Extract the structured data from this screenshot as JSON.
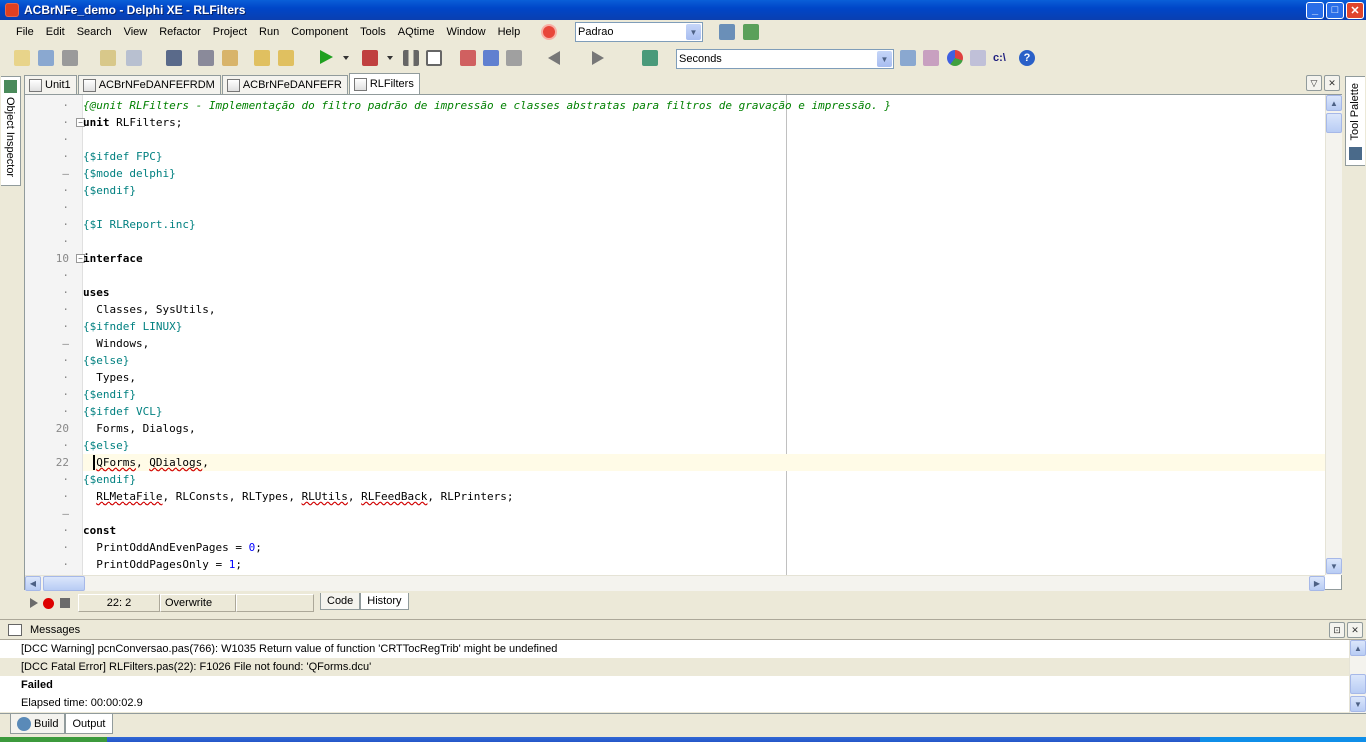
{
  "window": {
    "title": "ACBrNFe_demo - Delphi XE - RLFilters",
    "minimize": "_",
    "maximize": "□",
    "close": "✕"
  },
  "menubar": {
    "items": [
      "File",
      "Edit",
      "Search",
      "View",
      "Refactor",
      "Project",
      "Run",
      "Component",
      "Tools",
      "AQtime",
      "Window",
      "Help"
    ]
  },
  "desktop_combo": {
    "value": "Padrao"
  },
  "timing_combo": {
    "value": "Seconds"
  },
  "toolbar_icons": [
    "new-items-icon",
    "open-icon",
    "reopen-icon",
    "new-form-icon",
    "open-project-icon",
    "save-icon",
    "save-all-icon",
    "add-file-icon",
    "remove-file-icon",
    "run-icon",
    "run-without-debug-icon",
    "pause-icon",
    "stop-icon",
    "trace-into-icon",
    "step-over-icon",
    "run-to-cursor-icon",
    "back-icon",
    "forward-icon",
    "aqtime-icon",
    "components-icon",
    "help-icon"
  ],
  "side_left": {
    "label": "Object Inspector"
  },
  "side_right": {
    "label": "Tool Palette"
  },
  "editor_tabs": [
    {
      "label": "Unit1",
      "active": false
    },
    {
      "label": "ACBrNFeDANFEFRDM",
      "active": false
    },
    {
      "label": "ACBrNFeDANFEFR",
      "active": false
    },
    {
      "label": "RLFilters",
      "active": true
    }
  ],
  "code": {
    "comment_line": "{@unit RLFilters - Implementação do filtro padrão de impressão e classes abstratas para filtros de gravação e impressão. }",
    "unit_kw": "unit",
    "unit_name": " RLFilters;",
    "ifdef_fpc": "{$ifdef FPC}",
    "mode_delphi": "{$mode delphi}",
    "endif": "{$endif}",
    "include": "{$I RLReport.inc}",
    "interface": "interface",
    "uses": "uses",
    "classes_sysutils": "  Classes, SysUtils,",
    "ifndef_linux": "{$ifndef LINUX}",
    "windows": "  Windows,",
    "else": "{$else}",
    "types": "  Types,",
    "ifdef_vcl": "{$ifdef VCL}",
    "forms_dialogs": "  Forms, Dialogs,",
    "qforms": "QForms",
    "qdialogs": "QDialogs",
    "rlmetafile": "RLMetaFile",
    "rlconsts_types": ", RLConsts, RLTypes, ",
    "rlutils": "RLUtils",
    "rlfeedback": "RLFeedBack",
    "rlprinters": ", RLPrinters;",
    "const_kw": "const",
    "print_odd_even": "  PrintOddAndEvenPages = ",
    "print_odd_even_val": "0",
    "print_odd_only": "  PrintOddPagesOnly = ",
    "print_odd_only_val": "1",
    "line_10": "10",
    "line_20": "20",
    "line_22": "22"
  },
  "status": {
    "position": "22:  2",
    "mode": "Overwrite",
    "tab_code": "Code",
    "tab_history": "History"
  },
  "messages": {
    "title": "Messages",
    "lines": [
      "[DCC Warning] pcnConversao.pas(766): W1035 Return value of function 'CRTTocRegTrib' might be undefined",
      "[DCC Fatal Error] RLFilters.pas(22): F1026 File not found: 'QForms.dcu'",
      "Failed",
      "Elapsed time: 00:00:02.9"
    ],
    "tab_build": "Build",
    "tab_output": "Output"
  }
}
